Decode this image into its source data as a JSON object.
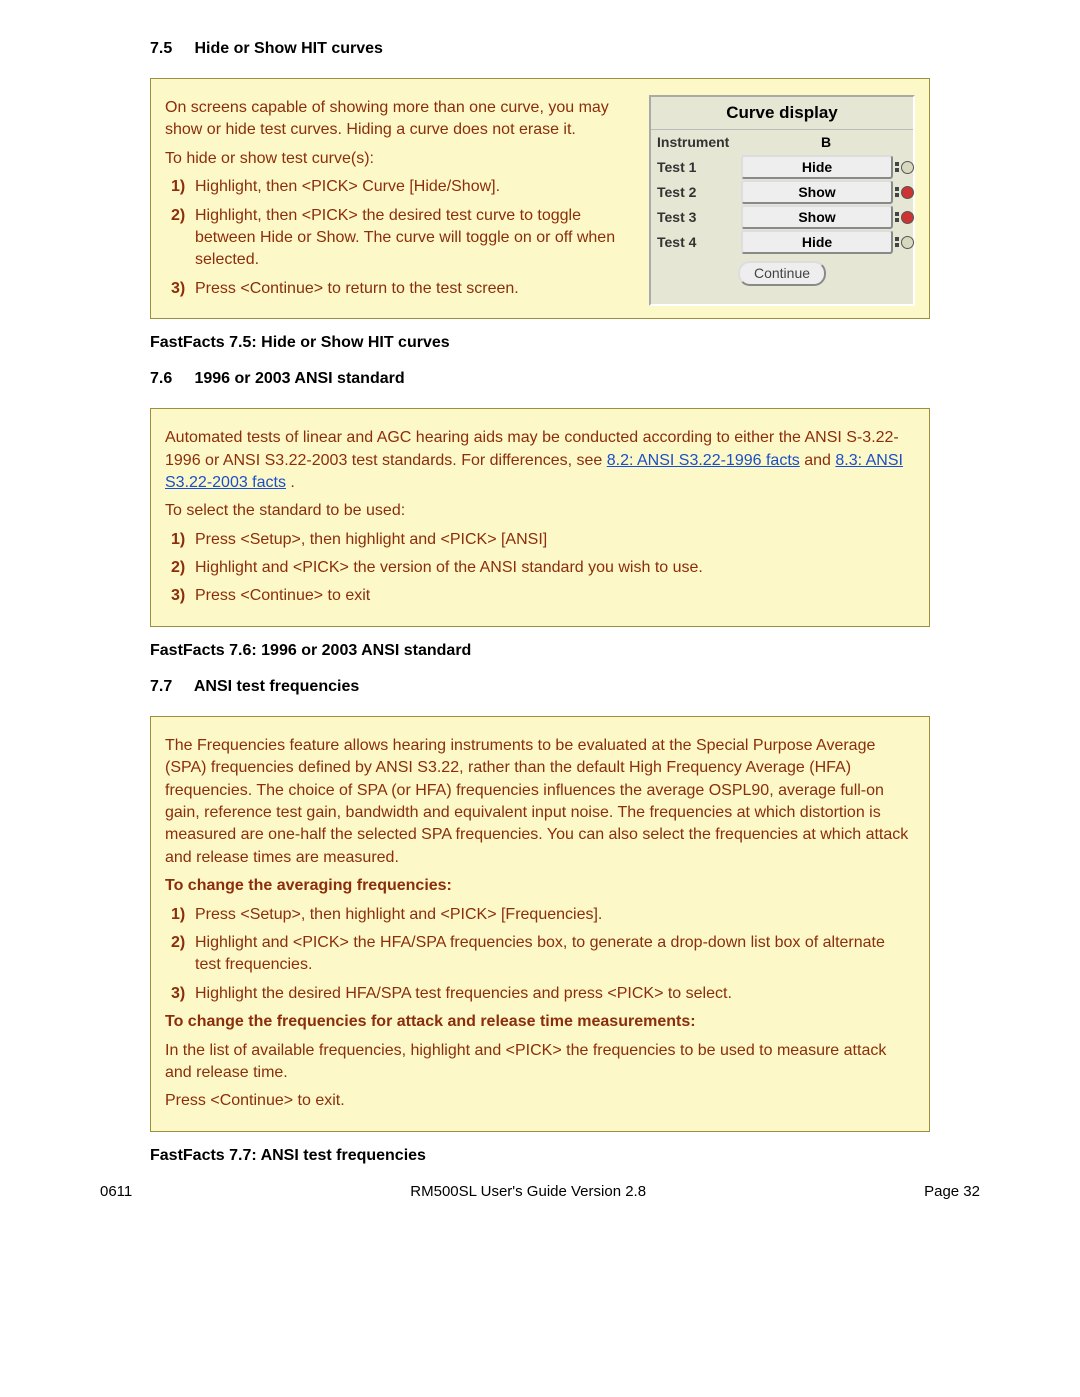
{
  "sections": {
    "s75": {
      "num": "7.5",
      "title": "Hide or Show HIT curves"
    },
    "s76": {
      "num": "7.6",
      "title": "1996 or 2003 ANSI standard"
    },
    "s77": {
      "num": "7.7",
      "title": "ANSI test frequencies"
    }
  },
  "box75": {
    "intro": "On screens capable of showing more than one curve, you may show or hide test curves. Hiding a curve does not erase it.",
    "lead": "To hide or show test curve(s):",
    "items": [
      "Highlight, then <PICK> Curve [Hide/Show].",
      "Highlight, then <PICK> the desired test curve to toggle between Hide or Show. The curve will toggle on or off when selected.",
      "Press <Continue> to return to the test screen."
    ]
  },
  "curve": {
    "title": "Curve display",
    "instrument_label": "Instrument",
    "instrument_value": "B",
    "rows": [
      {
        "label": "Test 1",
        "state": "Hide",
        "on": false
      },
      {
        "label": "Test 2",
        "state": "Show",
        "on": true
      },
      {
        "label": "Test 3",
        "state": "Show",
        "on": true
      },
      {
        "label": "Test 4",
        "state": "Hide",
        "on": false
      }
    ],
    "continue": "Continue"
  },
  "ff75": "FastFacts 7.5: Hide or Show HIT curves",
  "box76": {
    "intro_a": "Automated tests of linear and AGC hearing aids may be conducted according to either the ANSI S-3.22-1996 or ANSI S3.22-2003 test standards. For differences, see ",
    "link1": "8.2: ANSI S3.22-1996 facts",
    "mid": " and ",
    "link2": "8.3: ANSI S3.22-2003 facts",
    "end": ".",
    "lead": "To select the standard to be used:",
    "items": [
      "Press <Setup>, then highlight and <PICK> [ANSI]",
      "Highlight and <PICK> the version of the ANSI standard you wish to use.",
      "Press <Continue> to exit"
    ]
  },
  "ff76": "FastFacts 7.6: 1996 or 2003 ANSI standard",
  "box77": {
    "intro": "The Frequencies feature allows hearing instruments to be evaluated at the Special Purpose Average (SPA) frequencies defined by ANSI S3.22, rather than the default High Frequency Average (HFA) frequencies. The choice of SPA (or HFA) frequencies influences the average OSPL90, average full-on gain, reference test gain, bandwidth and equivalent input noise. The frequencies at which distortion is measured are one-half the selected SPA frequencies. You can also select the frequencies at which attack and release times are measured.",
    "sub1": "To change the averaging frequencies:",
    "items": [
      "Press <Setup>, then highlight and <PICK> [Frequencies].",
      "Highlight and <PICK> the HFA/SPA frequencies box, to generate a drop-down list box of alternate test frequencies.",
      "Highlight the desired HFA/SPA test frequencies and press <PICK> to select."
    ],
    "sub2": "To change the frequencies for attack and release time measurements:",
    "p2": "In the list of available frequencies, highlight and <PICK> the frequencies to be used to measure attack and release time.",
    "p3": "Press <Continue> to exit."
  },
  "ff77": "FastFacts 7.7: ANSI test frequencies",
  "footer": {
    "left": "0611",
    "center": "RM500SL User's Guide Version 2.8",
    "right": "Page 32"
  }
}
